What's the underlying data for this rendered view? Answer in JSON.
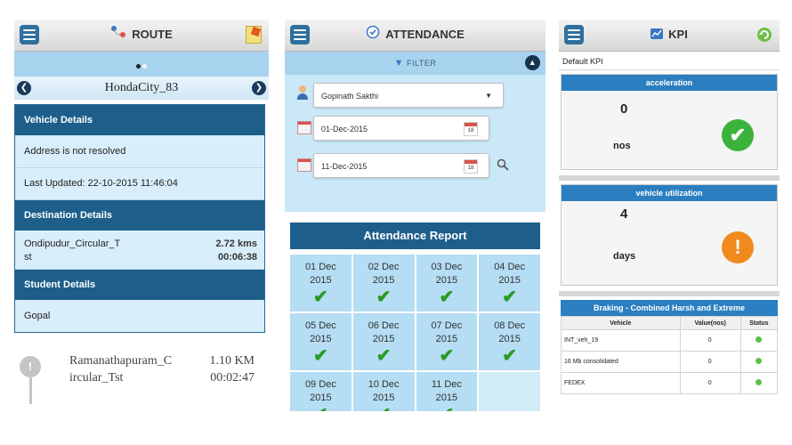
{
  "route": {
    "title": "ROUTE",
    "vehicle": "HondaCity_83",
    "prev_icon": "chevron-left-icon",
    "next_icon": "chevron-right-icon",
    "vehicle_details_heading": "Vehicle Details",
    "address": "Address is not resolved",
    "last_updated": "Last Updated: 22-10-2015 11:46:04",
    "destination_heading": "Destination Details",
    "destination_name_line1": "Ondipudur_Circular_T",
    "destination_name_line2": "st",
    "destination_distance": "2.72 kms",
    "destination_time": "00:06:38",
    "student_heading": "Student Details",
    "student_name": "Gopal",
    "next_stop_line1": "Ramanathapuram_C",
    "next_stop_line2": "ircular_Tst",
    "next_stop_distance": "1.10 KM",
    "next_stop_time": "00:02:47",
    "pin_label": "!"
  },
  "attendance": {
    "title": "ATTENDANCE",
    "filter_label": "FILTER",
    "person": "Gopinath Sakthi",
    "from_date": "01-Dec-2015",
    "to_date": "11-Dec-2015",
    "calendar_day": "18",
    "report_title": "Attendance Report",
    "check": "✔",
    "days": [
      {
        "day": "01 Dec",
        "year": "2015"
      },
      {
        "day": "02 Dec",
        "year": "2015"
      },
      {
        "day": "03 Dec",
        "year": "2015"
      },
      {
        "day": "04 Dec",
        "year": "2015"
      },
      {
        "day": "05 Dec",
        "year": "2015"
      },
      {
        "day": "06 Dec",
        "year": "2015"
      },
      {
        "day": "07 Dec",
        "year": "2015"
      },
      {
        "day": "08 Dec",
        "year": "2015"
      },
      {
        "day": "09 Dec",
        "year": "2015"
      },
      {
        "day": "10 Dec",
        "year": "2015"
      },
      {
        "day": "11 Dec",
        "year": "2015"
      }
    ]
  },
  "kpi": {
    "title": "KPI",
    "default_label": "Default KPI",
    "cards": [
      {
        "heading": "acceleration",
        "value": "0",
        "unit": "nos",
        "status_icon": "checkmark-icon",
        "color": "#3bb33b",
        "symbol": "✔"
      },
      {
        "heading": "vehicle utilization",
        "value": "4",
        "unit": "days",
        "status_icon": "exclamation-icon",
        "color": "#f08a1c",
        "symbol": "!"
      }
    ],
    "table_title": "Braking - Combined Harsh and Extreme",
    "table_headers": [
      "Vehicle",
      "Value(nos)",
      "Status"
    ],
    "table_rows": [
      {
        "vehicle": "INT_veh_19",
        "value": "0"
      },
      {
        "vehicle": "16 Mb consolidated",
        "value": "0"
      },
      {
        "vehicle": "FEDEX",
        "value": "0"
      }
    ],
    "status_color": "#5cc04a"
  }
}
